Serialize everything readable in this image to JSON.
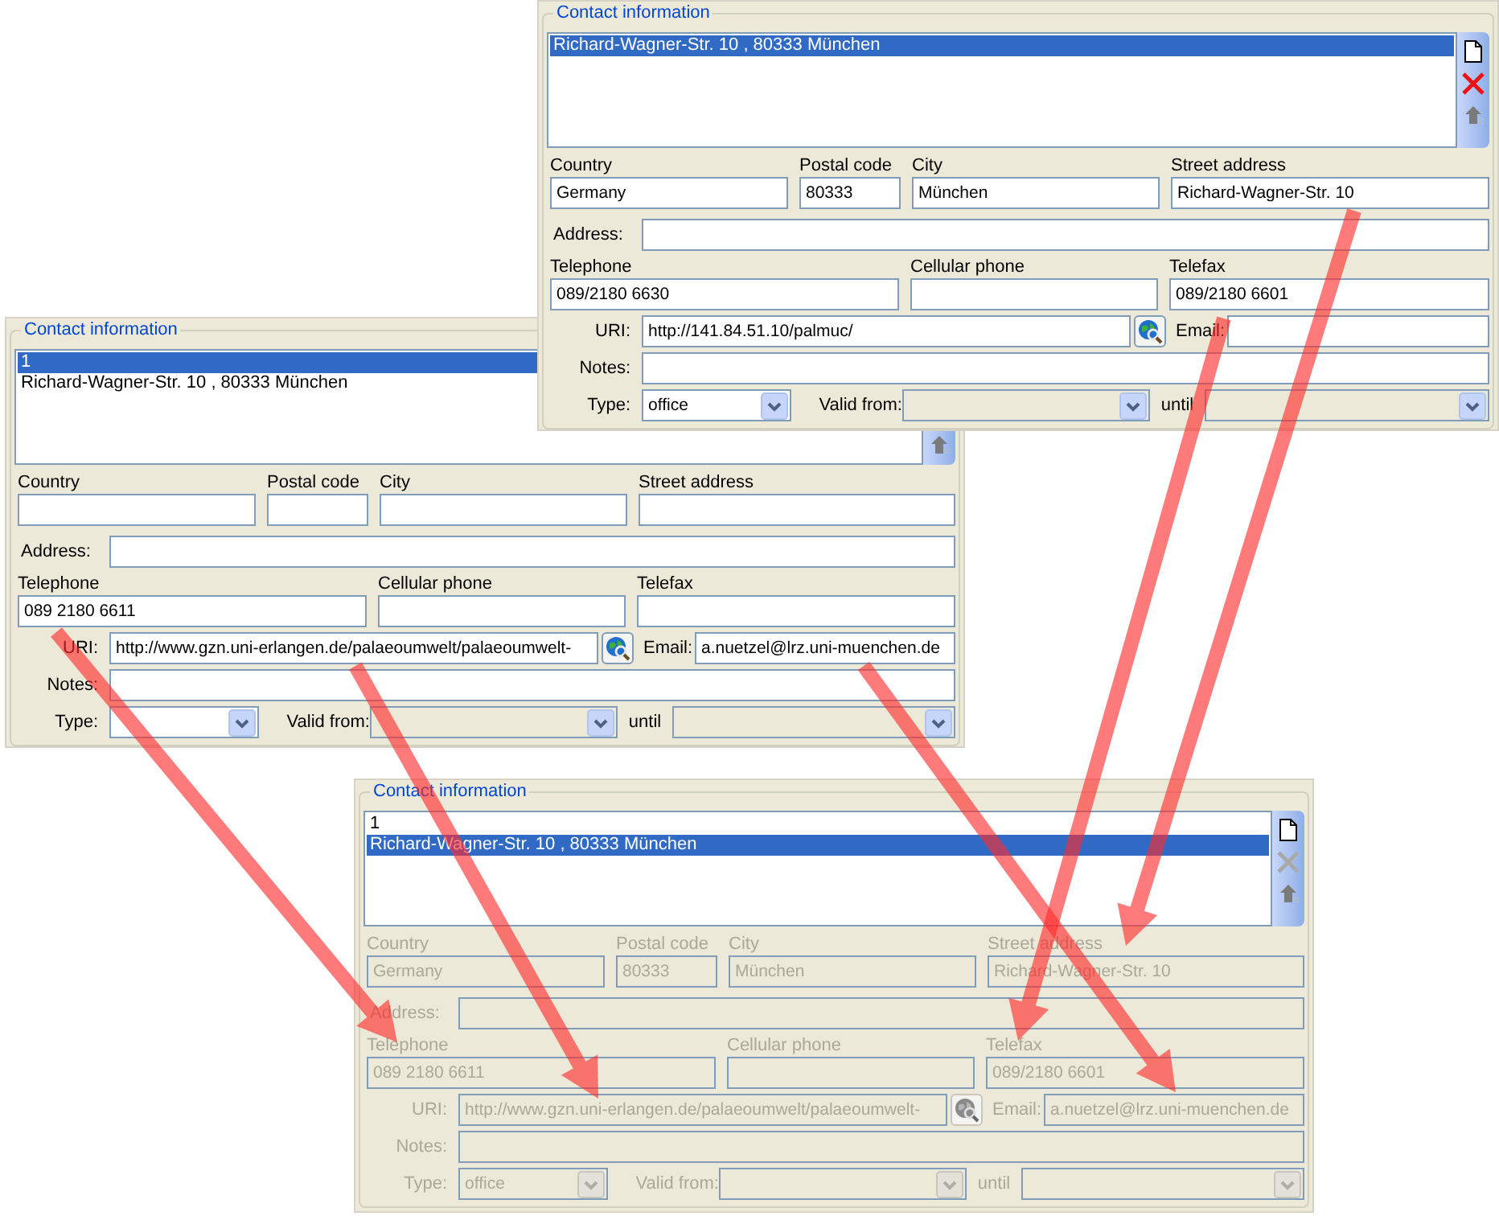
{
  "panels": [
    {
      "title": "Contact information",
      "disabled": false,
      "list": [
        {
          "text": "Richard-Wagner-Str. 10 , 80333 München",
          "selected": true
        }
      ],
      "buttons": [
        {
          "kind": "new",
          "disabled": false
        },
        {
          "kind": "delete",
          "disabled": false
        },
        {
          "kind": "up",
          "disabled": true
        }
      ],
      "fields": {
        "country": {
          "label": "Country",
          "value": "Germany"
        },
        "postal_code": {
          "label": "Postal code",
          "value": "80333"
        },
        "city": {
          "label": "City",
          "value": "München"
        },
        "street_address": {
          "label": "Street address",
          "value": "Richard-Wagner-Str. 10"
        },
        "address": {
          "label": "Address:"
        },
        "telephone": {
          "label": "Telephone",
          "value": "089/2180 6630"
        },
        "cellular_phone": {
          "label": "Cellular phone"
        },
        "telefax": {
          "label": "Telefax",
          "value": "089/2180 6601"
        },
        "uri": {
          "label": "URI:",
          "value": "http://141.84.51.10/palmuc/"
        },
        "email": {
          "label": "Email:"
        },
        "notes": {
          "label": "Notes:"
        },
        "type": {
          "label": "Type:",
          "value": "office"
        },
        "valid_from": {
          "label": "Valid from:"
        },
        "until": {
          "label": "until"
        }
      }
    },
    {
      "title": "Contact information",
      "disabled": false,
      "list": [
        {
          "text": "1",
          "selected": true
        },
        {
          "text": "Richard-Wagner-Str. 10 , 80333 München",
          "selected": false
        }
      ],
      "buttons": [
        {
          "kind": "up",
          "disabled": true
        }
      ],
      "fields": {
        "country": {
          "label": "Country"
        },
        "postal_code": {
          "label": "Postal code"
        },
        "city": {
          "label": "City"
        },
        "street_address": {
          "label": "Street address"
        },
        "address": {
          "label": "Address:"
        },
        "telephone": {
          "label": "Telephone",
          "value": "089 2180 6611"
        },
        "cellular_phone": {
          "label": "Cellular phone"
        },
        "telefax": {
          "label": "Telefax"
        },
        "uri": {
          "label": "URI:",
          "value": "http://www.gzn.uni-erlangen.de/palaeoumwelt/palaeoumwelt-"
        },
        "email": {
          "label": "Email:",
          "value": "a.nuetzel@lrz.uni-muenchen.de"
        },
        "notes": {
          "label": "Notes:"
        },
        "type": {
          "label": "Type:"
        },
        "valid_from": {
          "label": "Valid from:"
        },
        "until": {
          "label": "until"
        }
      }
    },
    {
      "title": "Contact information",
      "disabled": true,
      "list": [
        {
          "text": "1",
          "selected": false
        },
        {
          "text": "Richard-Wagner-Str. 10 , 80333 München",
          "selected": true
        }
      ],
      "buttons": [
        {
          "kind": "new",
          "disabled": false
        },
        {
          "kind": "delete",
          "disabled": true
        },
        {
          "kind": "up",
          "disabled": true
        }
      ],
      "fields": {
        "country": {
          "label": "Country",
          "value": "Germany"
        },
        "postal_code": {
          "label": "Postal code",
          "value": "80333"
        },
        "city": {
          "label": "City",
          "value": "München"
        },
        "street_address": {
          "label": "Street address",
          "value": "Richard-Wagner-Str. 10"
        },
        "address": {
          "label": "Address:"
        },
        "telephone": {
          "label": "Telephone",
          "value": "089 2180 6611"
        },
        "cellular_phone": {
          "label": "Cellular phone"
        },
        "telefax": {
          "label": "Telefax",
          "value": "089/2180 6601"
        },
        "uri": {
          "label": "URI:",
          "value": "http://www.gzn.uni-erlangen.de/palaeoumwelt/palaeoumwelt-"
        },
        "email": {
          "label": "Email:",
          "value": "a.nuetzel@lrz.uni-muenchen.de"
        },
        "notes": {
          "label": "Notes:"
        },
        "type": {
          "label": "Type:",
          "value": "office"
        },
        "valid_from": {
          "label": "Valid from:"
        },
        "until": {
          "label": "until"
        }
      }
    }
  ]
}
